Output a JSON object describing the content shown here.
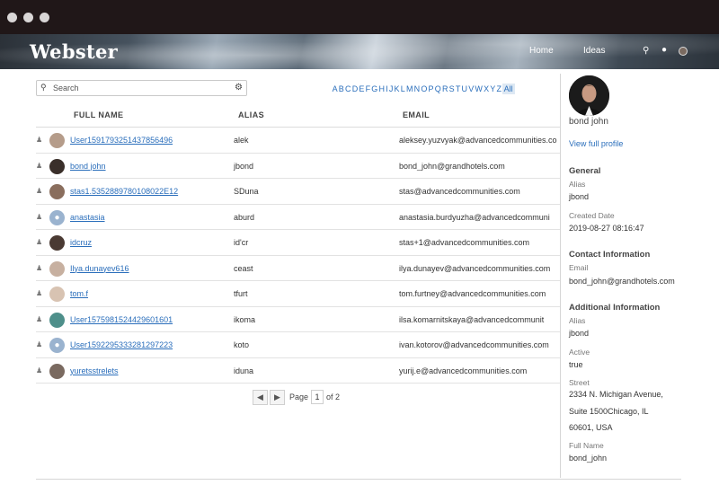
{
  "app": {
    "title": "Webster"
  },
  "nav": {
    "home": "Home",
    "ideas": "Ideas"
  },
  "search": {
    "placeholder": "Search"
  },
  "alphabet": [
    "A",
    "B",
    "C",
    "D",
    "E",
    "F",
    "G",
    "H",
    "I",
    "J",
    "K",
    "L",
    "M",
    "N",
    "O",
    "P",
    "Q",
    "R",
    "S",
    "T",
    "U",
    "V",
    "W",
    "X",
    "Y",
    "Z",
    "All"
  ],
  "table": {
    "headers": {
      "name": "FULL NAME",
      "alias": "ALIAS",
      "email": "EMAIL"
    },
    "rows": [
      {
        "name": "User1591793251437856496",
        "alias": "alek",
        "email": "aleksey.yuzvyak@advancedcommunities.co"
      },
      {
        "name": "bond john",
        "alias": "jbond",
        "email": "bond_john@grandhotels.com"
      },
      {
        "name": "stas1.5352889780108022E12",
        "alias": "SDuna",
        "email": "stas@advancedcommunities.com"
      },
      {
        "name": "anastasia",
        "alias": "aburd",
        "email": "anastasia.burdyuzha@advancedcommuni"
      },
      {
        "name": "idcruz",
        "alias": "id'cr",
        "email": "stas+1@advancedcommunities.com"
      },
      {
        "name": "Ilya.dunayev616",
        "alias": "ceast",
        "email": "ilya.dunayev@advancedcommunities.com"
      },
      {
        "name": "tom.f",
        "alias": "tfurt",
        "email": "tom.furtney@advancedcommunities.com"
      },
      {
        "name": "User1575981524429601601",
        "alias": "ikoma",
        "email": "ilsa.komarnitskaya@advancedcommunit"
      },
      {
        "name": "User1592295333281297223",
        "alias": "koto",
        "email": "ivan.kotorov@advancedcommunities.com"
      },
      {
        "name": "yuretsstrelets",
        "alias": "iduna",
        "email": "yurij.e@advancedcommunities.com"
      }
    ]
  },
  "pager": {
    "label": "Page",
    "current": "1",
    "of": "of 2"
  },
  "profile": {
    "name": "bond john",
    "view_link": "View full profile",
    "general": {
      "title": "General",
      "alias_label": "Alias",
      "alias": "jbond",
      "created_label": "Created Date",
      "created": "2019-08-27 08:16:47"
    },
    "contact": {
      "title": "Contact Information",
      "email_label": "Email",
      "email": "bond_john@grandhotels.com"
    },
    "additional": {
      "title": "Additional Information",
      "alias_label": "Alias",
      "alias": "jbond",
      "active_label": "Active",
      "active": "true",
      "street_label": "Street",
      "street1": "2334 N. Michigan Avenue,",
      "street2": "Suite 1500Chicago, IL",
      "street3": "60601, USA",
      "fullname_label": "Full Name",
      "fullname": "bond_john"
    }
  }
}
